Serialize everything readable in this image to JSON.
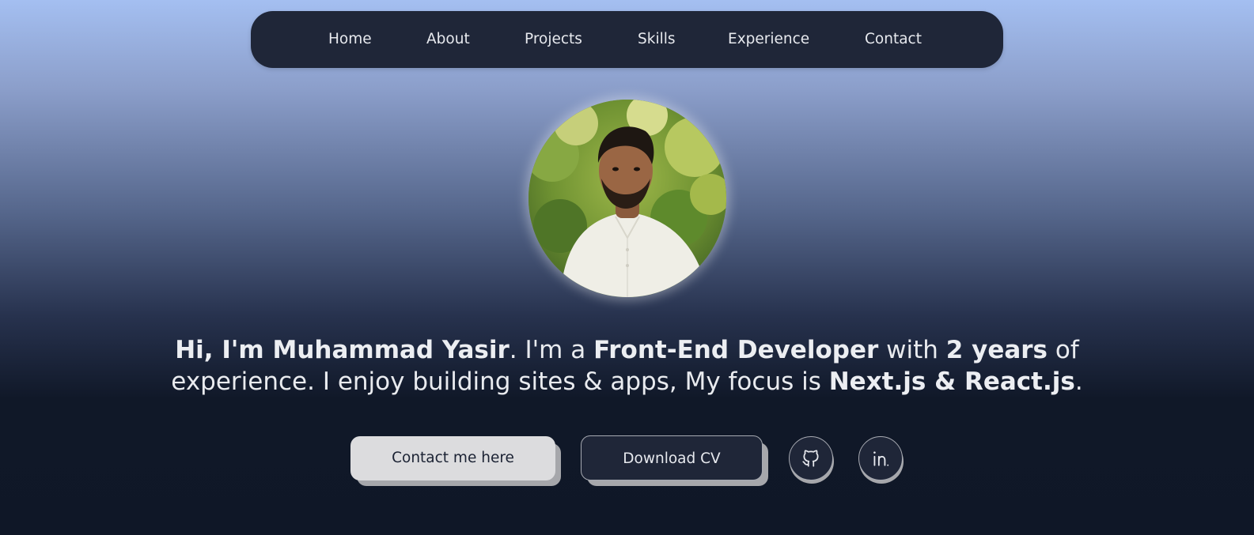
{
  "nav": {
    "items": [
      {
        "label": "Home"
      },
      {
        "label": "About"
      },
      {
        "label": "Projects"
      },
      {
        "label": "Skills"
      },
      {
        "label": "Experience"
      },
      {
        "label": "Contact"
      }
    ]
  },
  "hero": {
    "avatar_alt": "profile photo",
    "intro": {
      "greeting": "Hi, I'm Muhammad Yasir",
      "text_1": ". I'm a ",
      "role": "Front-End Developer",
      "text_2": " with ",
      "years": "2 years",
      "text_3": " of experience. I enjoy building sites & apps, My focus is ",
      "focus": "Next.js & React.js",
      "text_4": "."
    },
    "buttons": {
      "contact": "Contact me here",
      "download_cv": "Download CV"
    },
    "social": {
      "github_icon": "github-icon",
      "linkedin_icon": "linkedin-icon"
    }
  },
  "colors": {
    "nav_bg": "#1f2638",
    "page_bottom": "#0f1727",
    "page_top": "#a4bff1",
    "primary_button": "#dcdcde",
    "button_shadow": "#a6a7ab"
  }
}
